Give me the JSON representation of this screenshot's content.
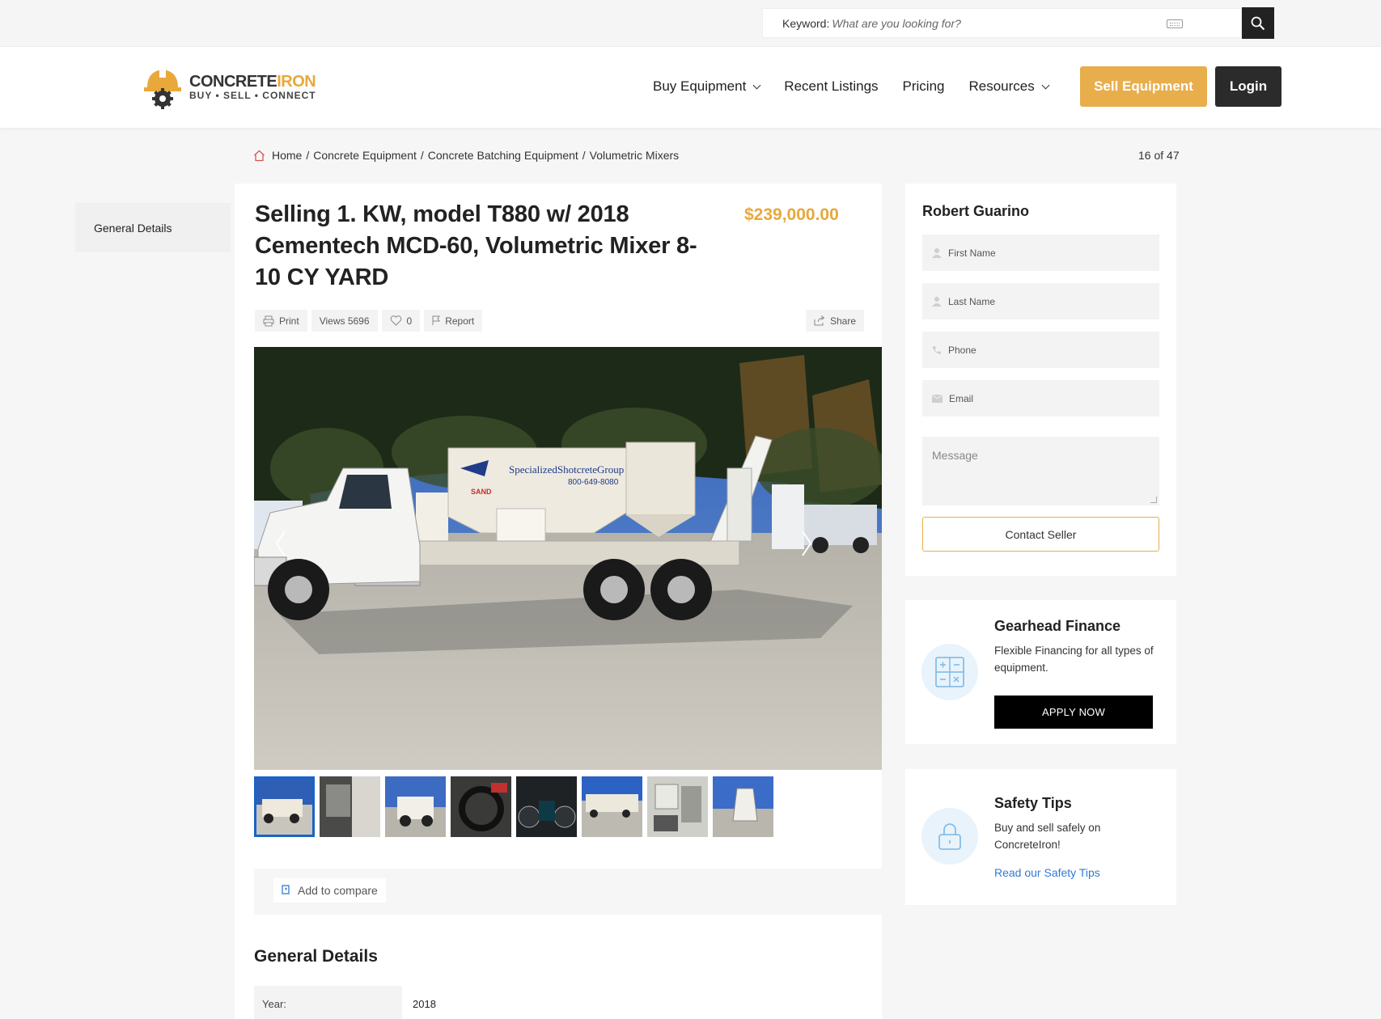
{
  "search": {
    "label": "Keyword:",
    "placeholder": "What are you looking for?"
  },
  "logo": {
    "name_part1": "CONCRETE",
    "name_part2": "IRON",
    "tagline": "BUY • SELL • CONNECT"
  },
  "nav": {
    "items": [
      {
        "label": "Buy Equipment",
        "dropdown": true
      },
      {
        "label": "Recent Listings",
        "dropdown": false
      },
      {
        "label": "Pricing",
        "dropdown": false
      },
      {
        "label": "Resources",
        "dropdown": true
      }
    ],
    "sell_label": "Sell Equipment",
    "login_label": "Login"
  },
  "breadcrumb": {
    "items": [
      "Home",
      "Concrete Equipment",
      "Concrete Batching Equipment",
      "Volumetric Mixers"
    ],
    "separator": "/"
  },
  "pager": {
    "current": "16",
    "of": "of",
    "total": "47"
  },
  "sidebar": {
    "tab_label": "General Details"
  },
  "listing": {
    "title": "Selling 1. KW, model T880 w/ 2018 Cementech MCD-60, Volumetric Mixer 8-10 CY YARD",
    "price": "$239,000.00",
    "actions": {
      "print": "Print",
      "views": "Views 5696",
      "likes": "0",
      "report": "Report",
      "share": "Share"
    },
    "truck_text": {
      "company": "SpecializedShotcreteGroup",
      "phone": "800-649-8080",
      "sand": "SAND"
    },
    "thumbnail_count": 8,
    "compare_label": "Add to compare",
    "general_details_title": "General Details",
    "details": [
      {
        "label": "Year:",
        "value": "2018"
      }
    ]
  },
  "contact": {
    "seller_name": "Robert Guarino",
    "first_name_placeholder": "First Name",
    "last_name_placeholder": "Last Name",
    "phone_placeholder": "Phone",
    "email_placeholder": "Email",
    "message_placeholder": "Message",
    "button_label": "Contact Seller"
  },
  "finance": {
    "title": "Gearhead Finance",
    "text": "Flexible Financing for all types of equipment.",
    "button_label": "APPLY NOW"
  },
  "safety": {
    "title": "Safety Tips",
    "text": "Buy and sell safely on ConcreteIron!",
    "link_label": "Read our Safety Tips"
  },
  "colors": {
    "accent": "#e8ae4c",
    "price": "#e8a83a",
    "dark": "#2b2b2b",
    "link": "#2f7bd6",
    "thumb_active": "#1a63c7"
  }
}
